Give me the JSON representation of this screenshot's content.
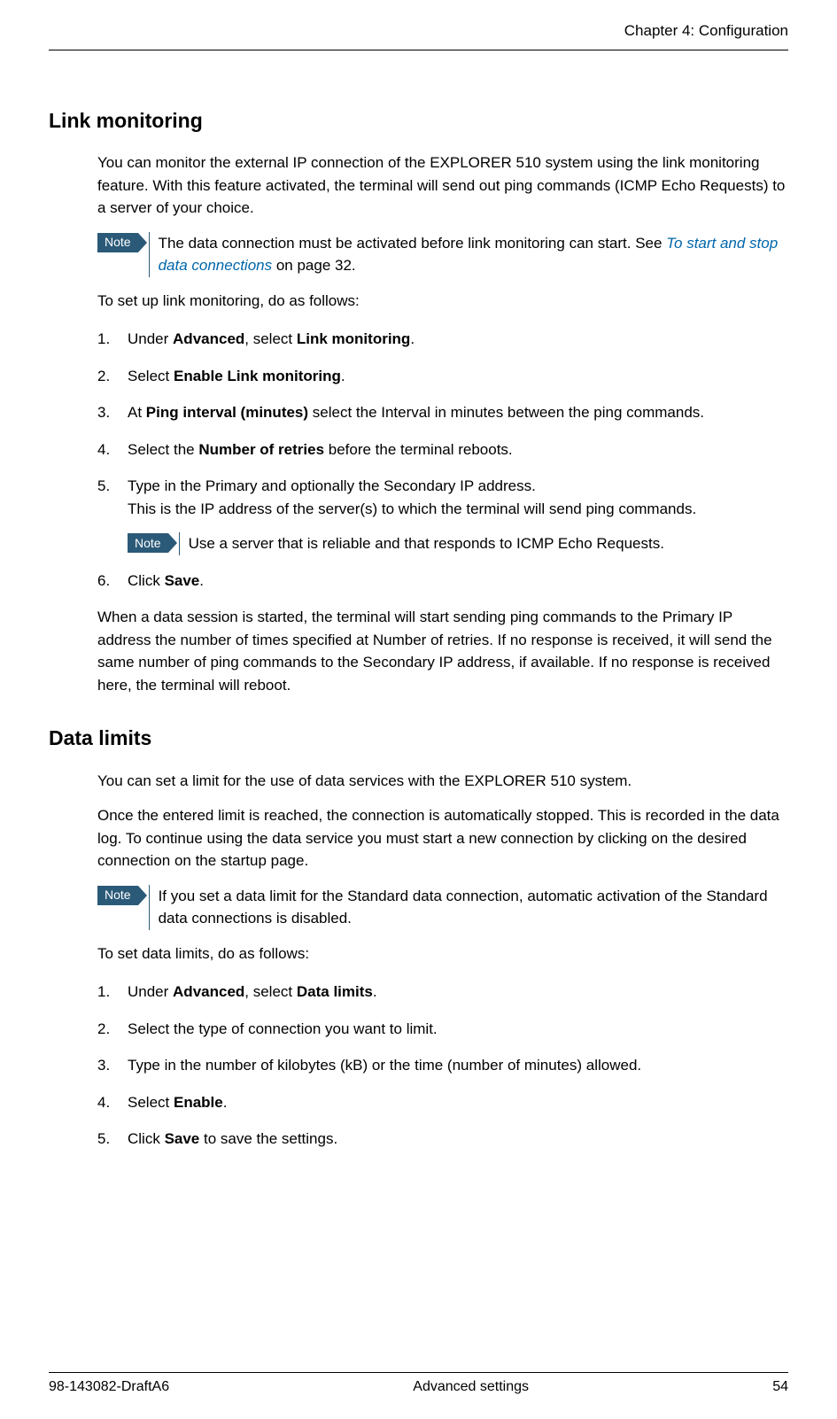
{
  "header": {
    "chapter": "Chapter 4: Configuration"
  },
  "section1": {
    "title": "Link monitoring",
    "intro": "You can monitor the external IP connection of the EXPLORER 510 system using the link monitoring feature. With this feature activated, the terminal will send out ping commands (ICMP Echo Requests) to a server of your choice.",
    "note1_label": "Note",
    "note1_pre": "The data connection must be activated before link monitoring can start. See ",
    "note1_link": "To start and stop data connections",
    "note1_post": " on page 32.",
    "setup_intro": "To set up link monitoring, do as follows:",
    "step1_pre": "Under ",
    "step1_b1": "Advanced",
    "step1_mid": ", select ",
    "step1_b2": "Link monitoring",
    "step1_post": ".",
    "step2_pre": "Select ",
    "step2_b1": "Enable Link monitoring",
    "step2_post": ".",
    "step3_pre": "At ",
    "step3_b1": "Ping interval (minutes)",
    "step3_post": " select the Interval in minutes between the ping commands.",
    "step4_pre": "Select the ",
    "step4_b1": "Number of retries",
    "step4_post": " before the terminal reboots.",
    "step5_line1": "Type in the Primary and optionally the Secondary IP address.",
    "step5_line2": "This is the IP address of the server(s) to which the terminal will send ping commands.",
    "step5_note_label": "Note",
    "step5_note_text": "Use a server that is reliable and that responds to ICMP Echo Requests.",
    "step6_pre": "Click ",
    "step6_b1": "Save",
    "step6_post": ".",
    "outro": "When a data session is started, the terminal will start sending ping commands to the Primary IP address the number of times specified at Number of retries. If no response is received, it will send the same number of ping commands to the Secondary IP address, if available. If no response is received here, the terminal will reboot."
  },
  "section2": {
    "title": "Data limits",
    "intro1": "You can set a limit for the use of data services with the EXPLORER 510 system.",
    "intro2": "Once the entered limit is reached, the connection is automatically stopped. This is recorded in the data log. To continue using the data service you must start a new connection by clicking on the desired connection on the startup page.",
    "note_label": "Note",
    "note_text": "If you set a data limit for the Standard data connection, automatic activation of the Standard data connections is disabled.",
    "setup_intro": "To set data limits, do as follows:",
    "step1_pre": "Under ",
    "step1_b1": "Advanced",
    "step1_mid": ", select ",
    "step1_b2": "Data limits",
    "step1_post": ".",
    "step2": "Select the type of connection you want to limit.",
    "step3": "Type in the number of kilobytes (kB) or the time (number of minutes) allowed.",
    "step4_pre": "Select ",
    "step4_b1": "Enable",
    "step4_post": ".",
    "step5_pre": "Click ",
    "step5_b1": "Save",
    "step5_post": " to save the settings."
  },
  "footer": {
    "doc_id": "98-143082-DraftA6",
    "section": "Advanced settings",
    "page": "54"
  }
}
